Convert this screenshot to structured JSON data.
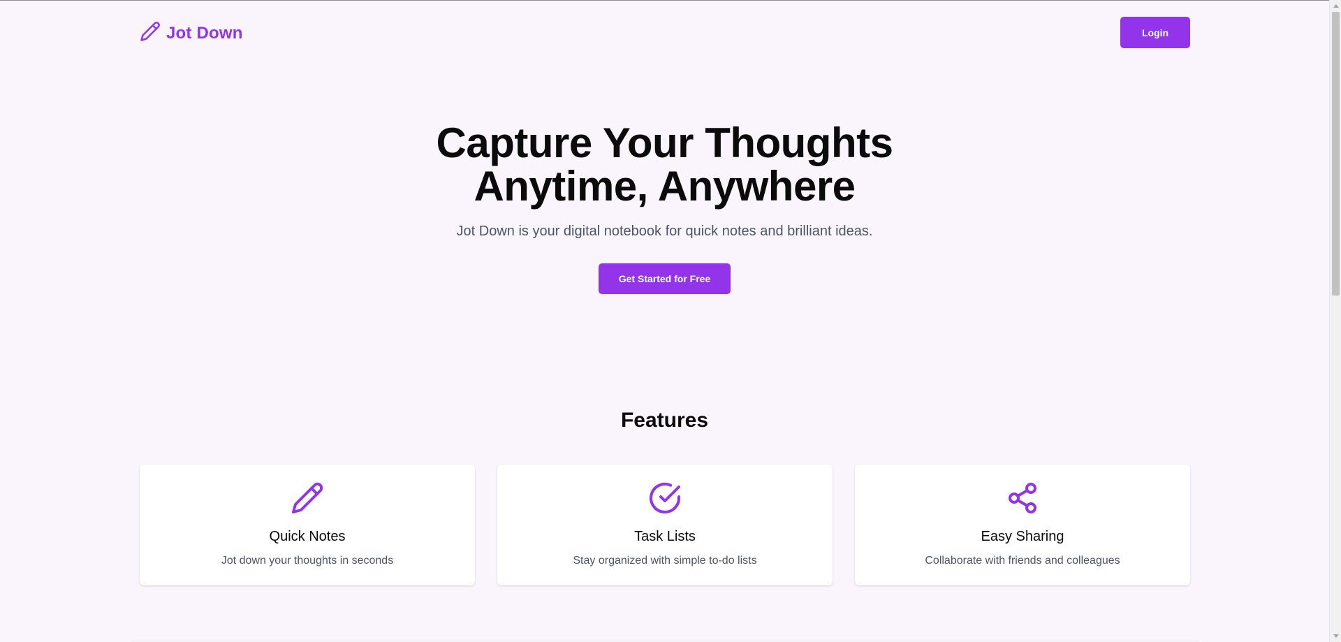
{
  "brand": {
    "name": "Jot Down",
    "icon": "pencil-icon",
    "color": "#9333ea"
  },
  "header": {
    "login_label": "Login"
  },
  "hero": {
    "title_line1": "Capture Your Thoughts",
    "title_line2": "Anytime, Anywhere",
    "subtitle": "Jot Down is your digital notebook for quick notes and brilliant ideas.",
    "cta_label": "Get Started for Free"
  },
  "features": {
    "heading": "Features",
    "items": [
      {
        "icon": "pencil-icon",
        "title": "Quick Notes",
        "description": "Jot down your thoughts in seconds"
      },
      {
        "icon": "check-circle-icon",
        "title": "Task Lists",
        "description": "Stay organized with simple to-do lists"
      },
      {
        "icon": "share-icon",
        "title": "Easy Sharing",
        "description": "Collaborate with friends and colleagues"
      }
    ]
  },
  "colors": {
    "accent": "#9333ea",
    "background": "#faf5fd",
    "muted_text": "#4b5563"
  }
}
